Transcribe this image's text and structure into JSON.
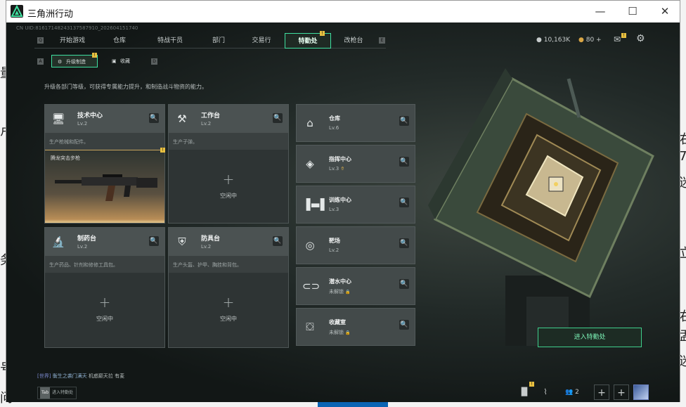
{
  "window": {
    "title": "三角洲行动",
    "min": "—",
    "max": "☐",
    "close": "✕"
  },
  "desktop": {
    "left_chars": [
      "量",
      "卢",
      "务",
      "号",
      "问"
    ],
    "right_chars": [
      "右",
      "7",
      "迷",
      "立",
      "右",
      "盂",
      "迷"
    ]
  },
  "uid": "CN UID:81617148243137587910_202604151740",
  "nav": {
    "items": [
      "开始游戏",
      "仓库",
      "特战干员",
      "部门",
      "交易行",
      "特勤处",
      "改枪台"
    ],
    "active_index": 5,
    "left_key": "Q",
    "right_key": "E",
    "badge": "!"
  },
  "resources": {
    "coins": "10,163K",
    "tickets": "80 +"
  },
  "subtabs": {
    "items": [
      "升级制造",
      "收藏"
    ],
    "left_key": "A",
    "right_key": "D",
    "badge": "!"
  },
  "description": "升级各部门等级，可获得专属能力提升，和制造战斗物资的能力。",
  "workshops": [
    {
      "name": "技术中心",
      "level": "Lv.2",
      "desc": "生产枪械和配件。",
      "icon": "monitor-icon",
      "status": "",
      "product": "腾龙突击步枪",
      "badge": "!"
    },
    {
      "name": "工作台",
      "level": "Lv.2",
      "desc": "生产子弹。",
      "icon": "tools-icon",
      "status": "空闲中"
    },
    {
      "name": "制药台",
      "level": "Lv.2",
      "desc": "生产药品、针剂和修修工具包。",
      "icon": "microscope-icon",
      "status": "空闲中"
    },
    {
      "name": "防具台",
      "level": "Lv.2",
      "desc": "生产头盔、护甲、胸挂和背包。",
      "icon": "armor-icon",
      "status": "空闲中"
    }
  ],
  "facilities": [
    {
      "name": "仓库",
      "level": "Lv.6",
      "icon": "warehouse-icon"
    },
    {
      "name": "指挥中心",
      "level": "Lv.3",
      "icon": "command-icon"
    },
    {
      "name": "训练中心",
      "level": "Lv.3",
      "icon": "dumbbell-icon"
    },
    {
      "name": "靶场",
      "level": "Lv.2",
      "icon": "target-icon"
    },
    {
      "name": "潜水中心",
      "level": "未解锁",
      "icon": "diving-icon"
    },
    {
      "name": "收藏室",
      "level": "未解锁",
      "icon": "collection-icon"
    }
  ],
  "plus": "+",
  "search_glyph": "🔍",
  "lock_glyph": "🔒",
  "enter_label": "进入特勤处",
  "chat": {
    "channel": "[世界]",
    "user": "衡生之袭门满天",
    "message": "机惑巅天拉 有麦"
  },
  "tab_hint": {
    "key": "Tab",
    "label": "进入特勤处"
  },
  "bottom": {
    "friends_count": "2"
  },
  "colors": {
    "accent": "#3fe0a0",
    "badge": "#e8c040"
  }
}
